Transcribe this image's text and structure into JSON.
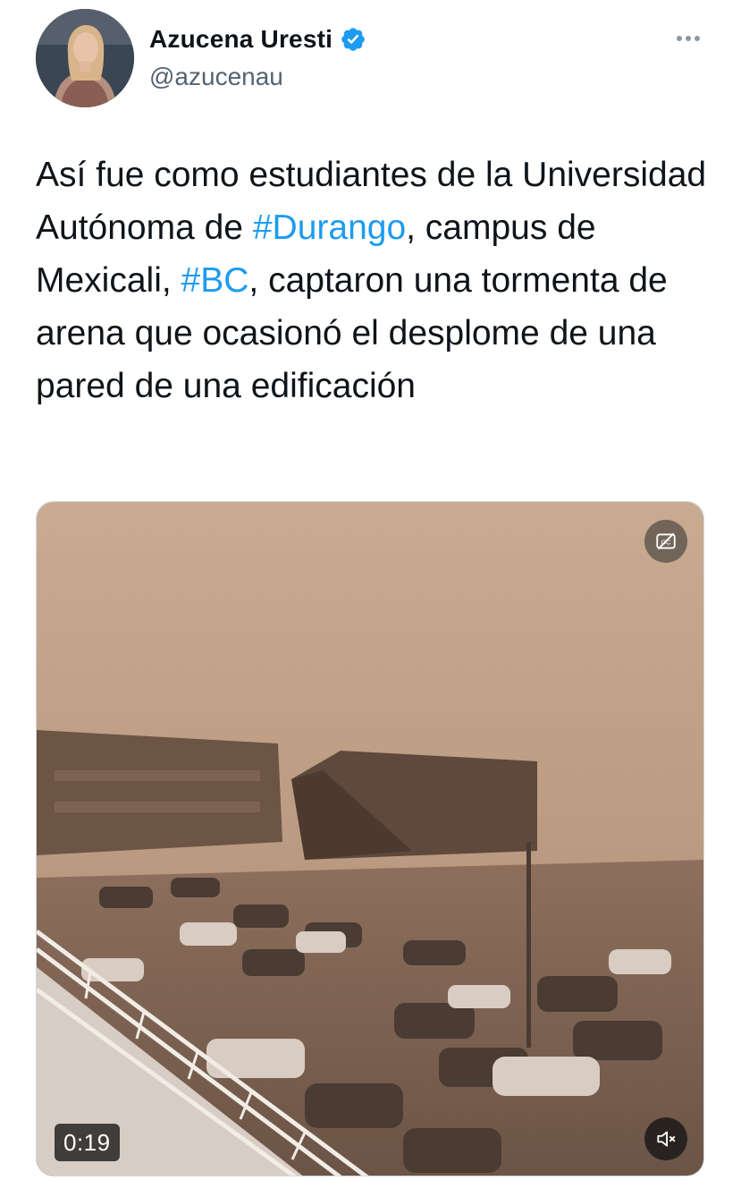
{
  "author": {
    "display_name": "Azucena Uresti",
    "handle": "@azucenau",
    "verified": true,
    "avatar_icon": "profile-photo"
  },
  "tweet": {
    "text_segments": [
      {
        "text": "Así fue como estudiantes de la Universidad Autónoma de ",
        "type": "text"
      },
      {
        "text": "#Durango",
        "type": "hashtag"
      },
      {
        "text": ", campus de Mexicali, ",
        "type": "text"
      },
      {
        "text": "#BC",
        "type": "hashtag"
      },
      {
        "text": ", captaron una tormenta de arena que ocasionó el desplome de una pared de una edificación",
        "type": "text"
      }
    ]
  },
  "media": {
    "type": "video",
    "duration": "0:19",
    "cc_icon": "closed-captions-off-icon",
    "mute_icon": "speaker-muted-icon"
  },
  "menu": {
    "icon": "more-horizontal-icon"
  },
  "colors": {
    "text": "#0f1419",
    "secondary": "#536471",
    "hashtag": "#1d9bf0",
    "verified": "#1d9bf0",
    "sand": "#b99a80"
  }
}
